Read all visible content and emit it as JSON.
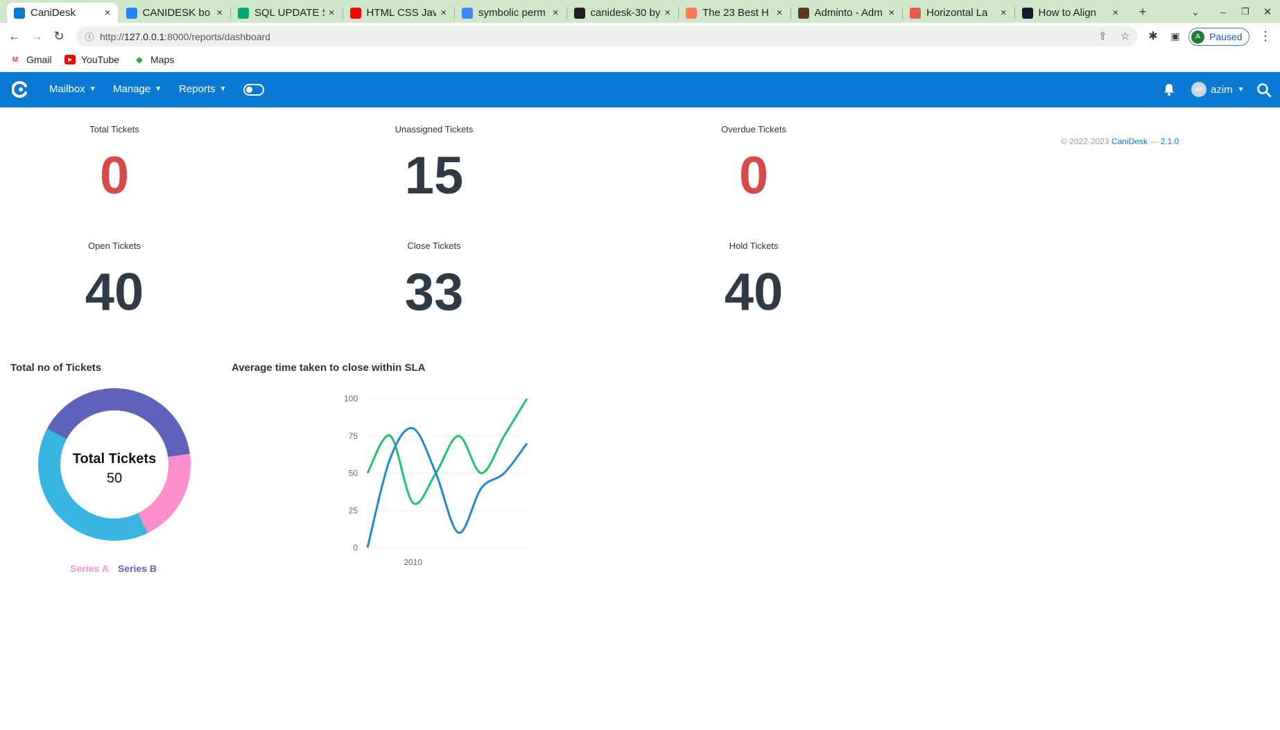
{
  "browser": {
    "tabs": [
      {
        "title": "CaniDesk",
        "icon": "canidesk-favicon",
        "color": "#0a79d4",
        "active": true
      },
      {
        "title": "CANIDESK bo",
        "icon": "jira-favicon",
        "color": "#2684ff"
      },
      {
        "title": "SQL UPDATE S",
        "icon": "w3schools-favicon",
        "color": "#04aa6d"
      },
      {
        "title": "HTML CSS Jav",
        "icon": "youtube-favicon",
        "color": "#ff0000"
      },
      {
        "title": "symbolic perm",
        "icon": "google-favicon",
        "color": "#4285f4"
      },
      {
        "title": "canidesk-30 by",
        "icon": "github-favicon",
        "color": "#1f1f1f"
      },
      {
        "title": "The 23 Best H",
        "icon": "hubspot-favicon",
        "color": "#ff7a59"
      },
      {
        "title": "Adminto - Adm",
        "icon": "adminto-favicon",
        "color": "#5a3a22"
      },
      {
        "title": "Horizontal La",
        "icon": "layout-favicon",
        "color": "#e8594d"
      },
      {
        "title": "How to Align",
        "icon": "howto-favicon",
        "color": "#1a1a2e"
      }
    ],
    "url_prefix": "http://",
    "url_host": "127.0.0.1",
    "url_rest": ":8000/reports/dashboard",
    "profile_initial": "A",
    "profile_status": "Paused",
    "bookmarks": [
      {
        "label": "Gmail",
        "icon": "gmail-icon"
      },
      {
        "label": "YouTube",
        "icon": "youtube-icon"
      },
      {
        "label": "Maps",
        "icon": "maps-icon"
      }
    ]
  },
  "app": {
    "menus": [
      {
        "label": "Mailbox"
      },
      {
        "label": "Manage"
      },
      {
        "label": "Reports"
      }
    ],
    "user_initials": "AP",
    "user_name": "azim",
    "brand_color": "#0a79d4"
  },
  "stats": [
    {
      "label": "Total Tickets",
      "value": "0",
      "alert": true
    },
    {
      "label": "Unassigned Tickets",
      "value": "15",
      "alert": false
    },
    {
      "label": "Overdue Tickets",
      "value": "0",
      "alert": true
    },
    {
      "label": "Open Tickets",
      "value": "40",
      "alert": false
    },
    {
      "label": "Close Tickets",
      "value": "33",
      "alert": false
    },
    {
      "label": "Hold Tickets",
      "value": "40",
      "alert": false
    }
  ],
  "footer": {
    "copyright": "© 2022-2023 ",
    "brand": "CaniDesk",
    "sep": " — ",
    "version": "2.1.0"
  },
  "sections": {
    "donut_title": "Total no of Tickets",
    "line_title": "Average time taken to close within SLA"
  },
  "chart_data": [
    {
      "type": "pie",
      "title": "Total no of Tickets",
      "center_label": "Total Tickets",
      "center_value": "50",
      "series": [
        {
          "name": "Series A",
          "value": 10,
          "color": "#fd8fcd"
        },
        {
          "name": "Series B",
          "value": 20,
          "color": "#5c63b8"
        },
        {
          "name": "",
          "value": 20,
          "color": "#38b5e0"
        }
      ],
      "legend": [
        "Series A",
        "Series B"
      ],
      "legend_position": "bottom"
    },
    {
      "type": "line",
      "title": "Average time taken to close within SLA",
      "x": [
        0,
        1,
        2,
        3,
        4,
        5,
        6,
        7
      ],
      "xtick_label": "2010",
      "yticks": [
        0,
        25,
        50,
        75,
        100
      ],
      "ylim": [
        0,
        100
      ],
      "series": [
        {
          "values": [
            50,
            75,
            30,
            50,
            75,
            50,
            75,
            100
          ],
          "color": "#1ec36a"
        },
        {
          "values": [
            0,
            60,
            80,
            50,
            10,
            40,
            50,
            70
          ],
          "color": "#1e88d6"
        }
      ]
    }
  ]
}
